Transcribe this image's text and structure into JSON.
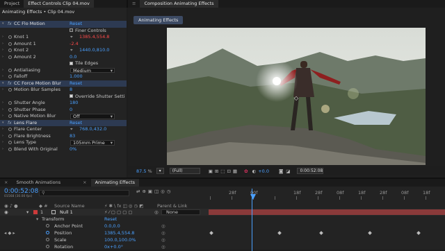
{
  "left_panel": {
    "tabs": [
      "Project",
      "Effect Controls Clip 04.mov"
    ],
    "header": "Animating Effects • Clip 04.mov",
    "rows": [
      {
        "type": "fx",
        "label": "CC Flo Motion",
        "value": "Reset"
      },
      {
        "type": "check",
        "label": "",
        "value": "Finer Controls",
        "checked": false
      },
      {
        "type": "prop",
        "label": "Knot 1",
        "value": "1385.4,554.8",
        "value_color": "#ff4a4a",
        "icon": "crosshair"
      },
      {
        "type": "prop",
        "label": "Amount 1",
        "value": "-2.4",
        "value_color": "#ff4a4a"
      },
      {
        "type": "prop",
        "label": "Knot 2",
        "value": "1440.0,810.0",
        "icon": "crosshair"
      },
      {
        "type": "prop",
        "label": "Amount 2",
        "value": "0.0"
      },
      {
        "type": "check",
        "label": "",
        "value": "Tile Edges",
        "checked": true
      },
      {
        "type": "select",
        "label": "Antialiasing",
        "value": "Medium"
      },
      {
        "type": "prop",
        "label": "Falloff",
        "value": "1.000"
      },
      {
        "type": "fx",
        "label": "CC Force Motion Blur",
        "value": "Reset"
      },
      {
        "type": "prop",
        "label": "Motion Blur Samples",
        "value": "8"
      },
      {
        "type": "check",
        "label": "",
        "value": "Override Shutter Setti",
        "checked": true
      },
      {
        "type": "prop",
        "label": "Shutter Angle",
        "value": "180"
      },
      {
        "type": "prop",
        "label": "Shutter Phase",
        "value": "0"
      },
      {
        "type": "select",
        "label": "Native Motion Blur",
        "value": "Off"
      },
      {
        "type": "fx",
        "label": "Lens Flare",
        "value": "Reset"
      },
      {
        "type": "prop",
        "label": "Flare Center",
        "value": "768.0,432.0",
        "icon": "crosshair"
      },
      {
        "type": "prop",
        "label": "Flare Brightness",
        "value": "83"
      },
      {
        "type": "select",
        "label": "Lens Type",
        "value": "105mm Prime"
      },
      {
        "type": "prop",
        "label": "Blend With Original",
        "value": "0%"
      }
    ]
  },
  "viewer": {
    "tab": "Composition Animating Effects",
    "subtab": "Animating Effects",
    "zoom": "87.5",
    "resolution": "(Full)",
    "exposure": "+0.0",
    "timecode": "0:00:52:08"
  },
  "timeline": {
    "tabs": [
      "Smooth Animations",
      "Animating Effects"
    ],
    "timecode": "0:00:52:08",
    "frame_info": "01568 (30.00 fps)",
    "search_placeholder": "",
    "columns": {
      "source": "Source Name",
      "parent": "Parent & Link"
    },
    "ruler": [
      "",
      "28f",
      "00f",
      "",
      "18f",
      "28f",
      "08f",
      "18f",
      "28f",
      "08f",
      "18f"
    ],
    "layer": {
      "num": "1",
      "name": "Null 1",
      "parent": "None"
    },
    "transform": {
      "label": "Transform",
      "reset": "Reset"
    },
    "props": [
      {
        "label": "Anchor Point",
        "value": "0.0,0.0"
      },
      {
        "label": "Position",
        "value": "1385.4,554.8"
      },
      {
        "label": "Scale",
        "value": "100.0,100.0%"
      },
      {
        "label": "Rotation",
        "value": "0x+0.0°"
      }
    ]
  },
  "colors": {
    "accent": "#4aa0ff",
    "label_red": "#cc3a3a",
    "layer_bar": "#8a3a3a"
  }
}
